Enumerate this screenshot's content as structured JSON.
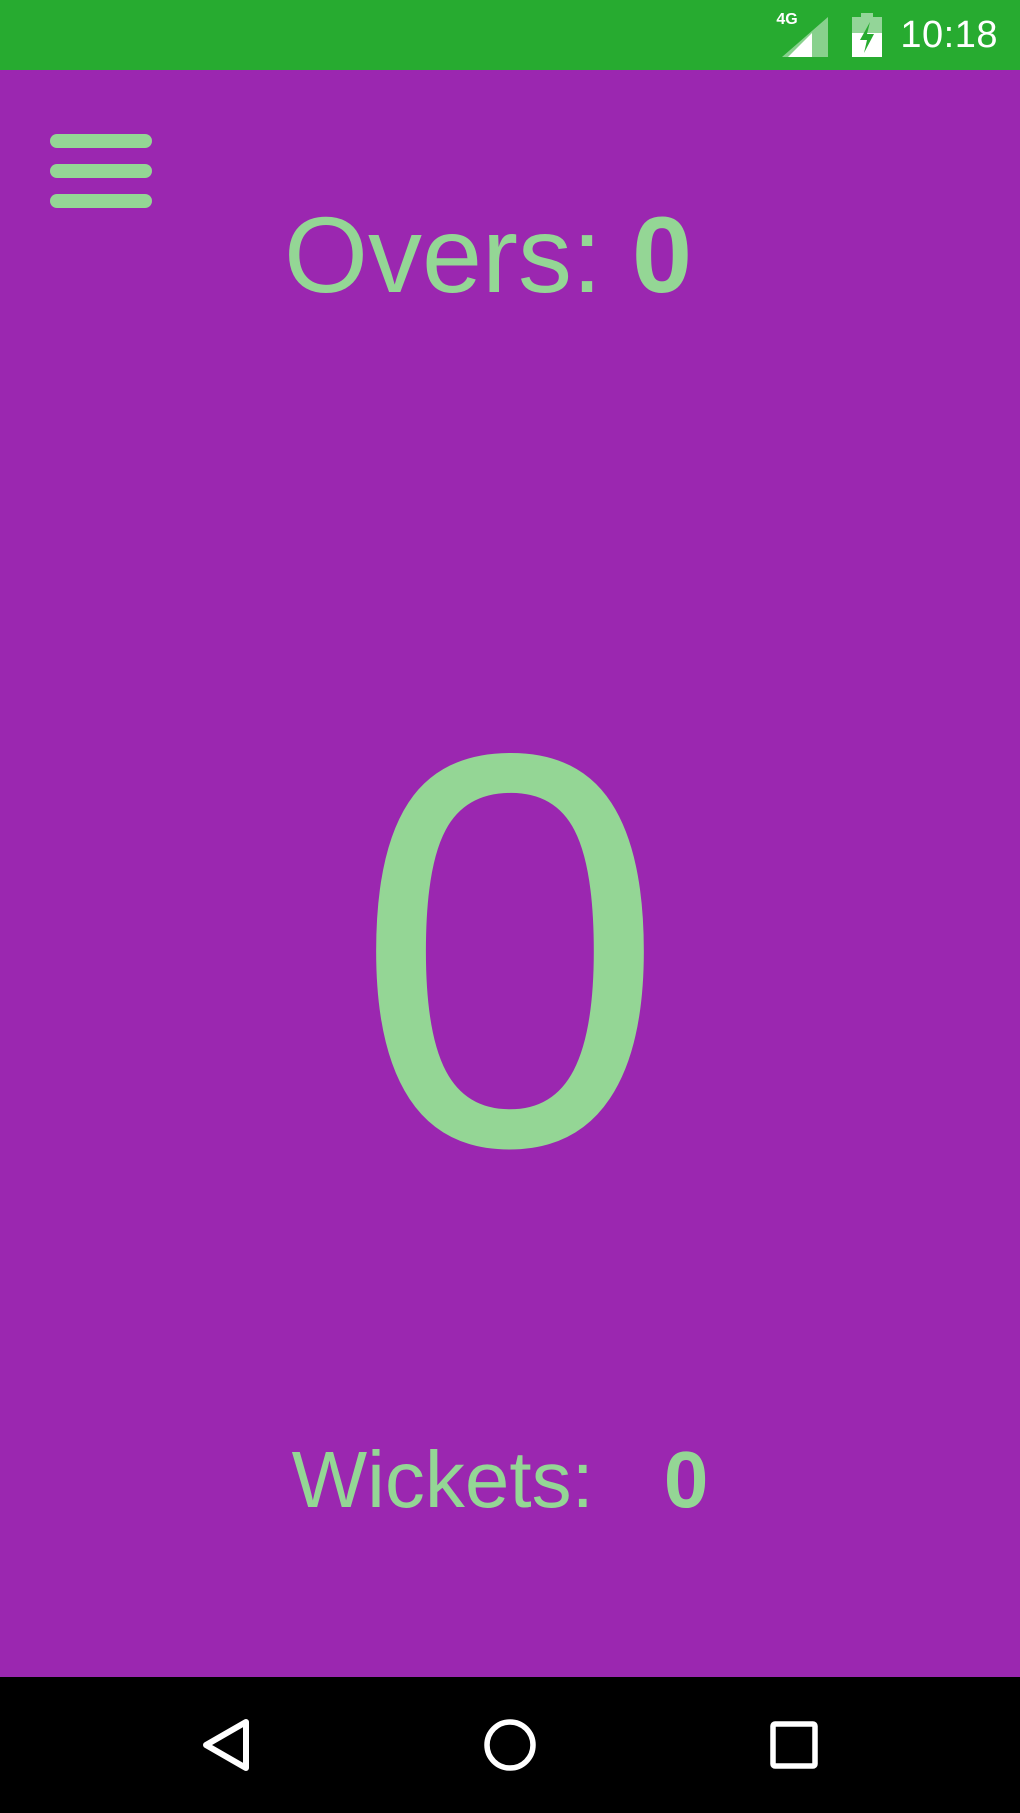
{
  "status_bar": {
    "network_label": "4G",
    "time": "10:18",
    "background_color": "#27ab30",
    "icons": [
      "signal-icon",
      "battery-charging-icon"
    ]
  },
  "app": {
    "background_color": "#9b27b0",
    "accent_color": "#94d695",
    "menu_icon": "hamburger-menu-icon",
    "overs_label": "Overs:",
    "overs_value": "0",
    "score_value": "0",
    "wickets_label": "Wickets:",
    "wickets_value": "0"
  },
  "nav_bar": {
    "buttons": [
      "back-icon",
      "home-icon",
      "recents-icon"
    ]
  }
}
